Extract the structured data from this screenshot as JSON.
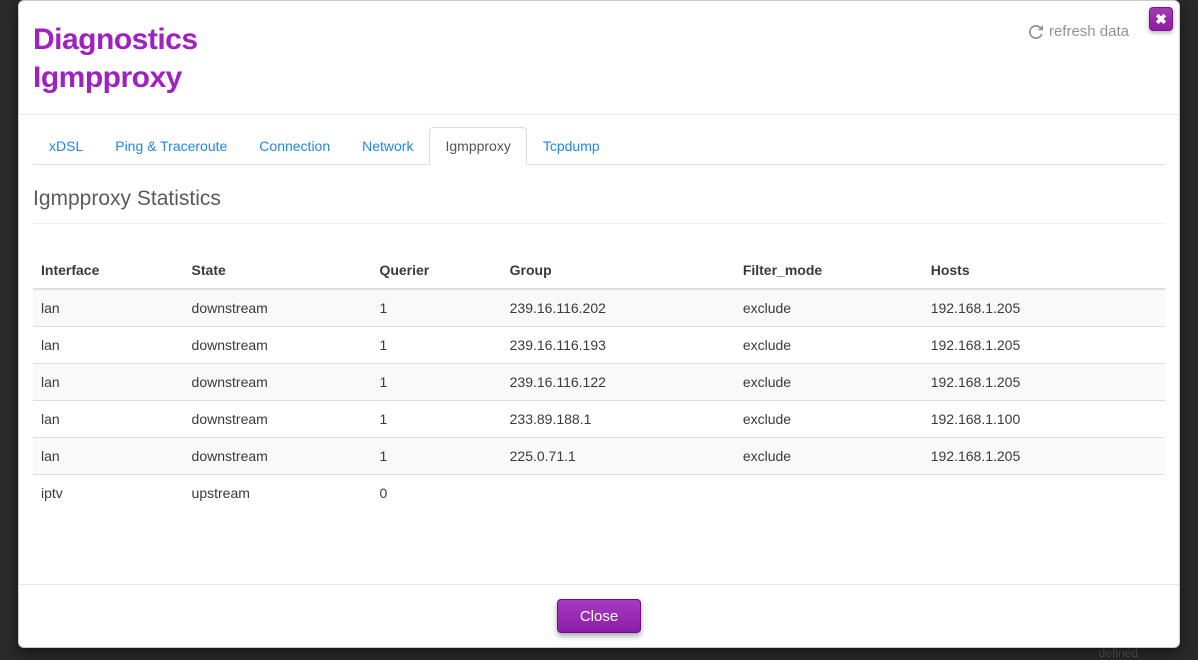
{
  "header": {
    "title_line1": "Diagnostics",
    "title_line2": "Igmpproxy",
    "refresh_label": "refresh data"
  },
  "tabs": [
    {
      "label": "xDSL",
      "active": false
    },
    {
      "label": "Ping & Traceroute",
      "active": false
    },
    {
      "label": "Connection",
      "active": false
    },
    {
      "label": "Network",
      "active": false
    },
    {
      "label": "Igmpproxy",
      "active": true
    },
    {
      "label": "Tcpdump",
      "active": false
    }
  ],
  "section": {
    "title": "Igmpproxy Statistics"
  },
  "table": {
    "columns": [
      "Interface",
      "State",
      "Querier",
      "Group",
      "Filter_mode",
      "Hosts"
    ],
    "rows": [
      {
        "interface": "lan",
        "state": "downstream",
        "querier": "1",
        "group": "239.16.116.202",
        "filter_mode": "exclude",
        "hosts": "192.168.1.205"
      },
      {
        "interface": "lan",
        "state": "downstream",
        "querier": "1",
        "group": "239.16.116.193",
        "filter_mode": "exclude",
        "hosts": "192.168.1.205"
      },
      {
        "interface": "lan",
        "state": "downstream",
        "querier": "1",
        "group": "239.16.116.122",
        "filter_mode": "exclude",
        "hosts": "192.168.1.205"
      },
      {
        "interface": "lan",
        "state": "downstream",
        "querier": "1",
        "group": "233.89.188.1",
        "filter_mode": "exclude",
        "hosts": "192.168.1.100"
      },
      {
        "interface": "lan",
        "state": "downstream",
        "querier": "1",
        "group": "225.0.71.1",
        "filter_mode": "exclude",
        "hosts": "192.168.1.205"
      },
      {
        "interface": "iptv",
        "state": "upstream",
        "querier": "0",
        "group": "",
        "filter_mode": "",
        "hosts": ""
      }
    ]
  },
  "footer": {
    "close_label": "Close"
  },
  "bg_hint": "defined"
}
